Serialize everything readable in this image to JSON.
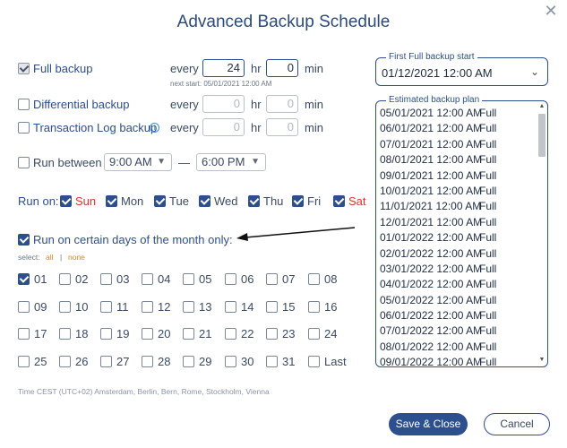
{
  "dialog": {
    "title": "Advanced Backup Schedule"
  },
  "icons": {
    "close": "close-icon",
    "info": "info-icon",
    "chevron": "chevron-down-icon",
    "arrow": "arrow-left-annotation"
  },
  "colors": {
    "primary": "#2d4f8e",
    "weekend": "#d9362b",
    "link": "#e8821a"
  },
  "full_backup": {
    "label": "Full backup",
    "every": "every",
    "hours": "24",
    "hr": "hr",
    "minutes": "0",
    "min": "min",
    "next_start": "next start: 05/01/2021 12:00 AM"
  },
  "differential": {
    "label": "Differential backup",
    "every": "every",
    "hours": "0",
    "hr": "hr",
    "minutes": "0",
    "min": "min"
  },
  "transaction_log": {
    "label": "Transaction Log backup",
    "every": "every",
    "hours": "0",
    "hr": "hr",
    "minutes": "0",
    "min": "min"
  },
  "run_between": {
    "label": "Run between",
    "from": "9:00 AM",
    "dash": "—",
    "to": "6:00 PM"
  },
  "run_on": {
    "label": "Run on:",
    "days": [
      {
        "name": "Sun",
        "checked": true,
        "weekend": true
      },
      {
        "name": "Mon",
        "checked": true,
        "weekend": false
      },
      {
        "name": "Tue",
        "checked": true,
        "weekend": false
      },
      {
        "name": "Wed",
        "checked": true,
        "weekend": false
      },
      {
        "name": "Thu",
        "checked": true,
        "weekend": false
      },
      {
        "name": "Fri",
        "checked": true,
        "weekend": false
      },
      {
        "name": "Sat",
        "checked": true,
        "weekend": true
      }
    ]
  },
  "month_days": {
    "label": "Run on certain days of the month only:",
    "select_label": "select:",
    "all": "all",
    "separator": "|",
    "none": "none",
    "days": [
      "01",
      "02",
      "03",
      "04",
      "05",
      "06",
      "07",
      "08",
      "09",
      "10",
      "11",
      "12",
      "13",
      "14",
      "15",
      "16",
      "17",
      "18",
      "19",
      "20",
      "21",
      "22",
      "23",
      "24",
      "25",
      "26",
      "27",
      "28",
      "29",
      "30",
      "31",
      "Last"
    ],
    "checked": [
      "01"
    ]
  },
  "timezone": "Time CEST (UTC+02) Amsterdam, Berlin, Bern, Rome, Stockholm, Vienna",
  "first_full": {
    "legend": "First Full backup start",
    "value": "01/12/2021 12:00 AM"
  },
  "plan": {
    "legend": "Estimated backup plan",
    "rows": [
      {
        "time": "05/01/2021 12:00 AM",
        "type": "Full"
      },
      {
        "time": "06/01/2021 12:00 AM",
        "type": "Full"
      },
      {
        "time": "07/01/2021 12:00 AM",
        "type": "Full"
      },
      {
        "time": "08/01/2021 12:00 AM",
        "type": "Full"
      },
      {
        "time": "09/01/2021 12:00 AM",
        "type": "Full"
      },
      {
        "time": "10/01/2021 12:00 AM",
        "type": "Full"
      },
      {
        "time": "11/01/2021 12:00 AM",
        "type": "Full"
      },
      {
        "time": "12/01/2021 12:00 AM",
        "type": "Full"
      },
      {
        "time": "01/01/2022 12:00 AM",
        "type": "Full"
      },
      {
        "time": "02/01/2022 12:00 AM",
        "type": "Full"
      },
      {
        "time": "03/01/2022 12:00 AM",
        "type": "Full"
      },
      {
        "time": "04/01/2022 12:00 AM",
        "type": "Full"
      },
      {
        "time": "05/01/2022 12:00 AM",
        "type": "Full"
      },
      {
        "time": "06/01/2022 12:00 AM",
        "type": "Full"
      },
      {
        "time": "07/01/2022 12:00 AM",
        "type": "Full"
      },
      {
        "time": "08/01/2022 12:00 AM",
        "type": "Full"
      },
      {
        "time": "09/01/2022 12:00 AM",
        "type": "Full"
      }
    ]
  },
  "buttons": {
    "save": "Save & Close",
    "cancel": "Cancel"
  }
}
